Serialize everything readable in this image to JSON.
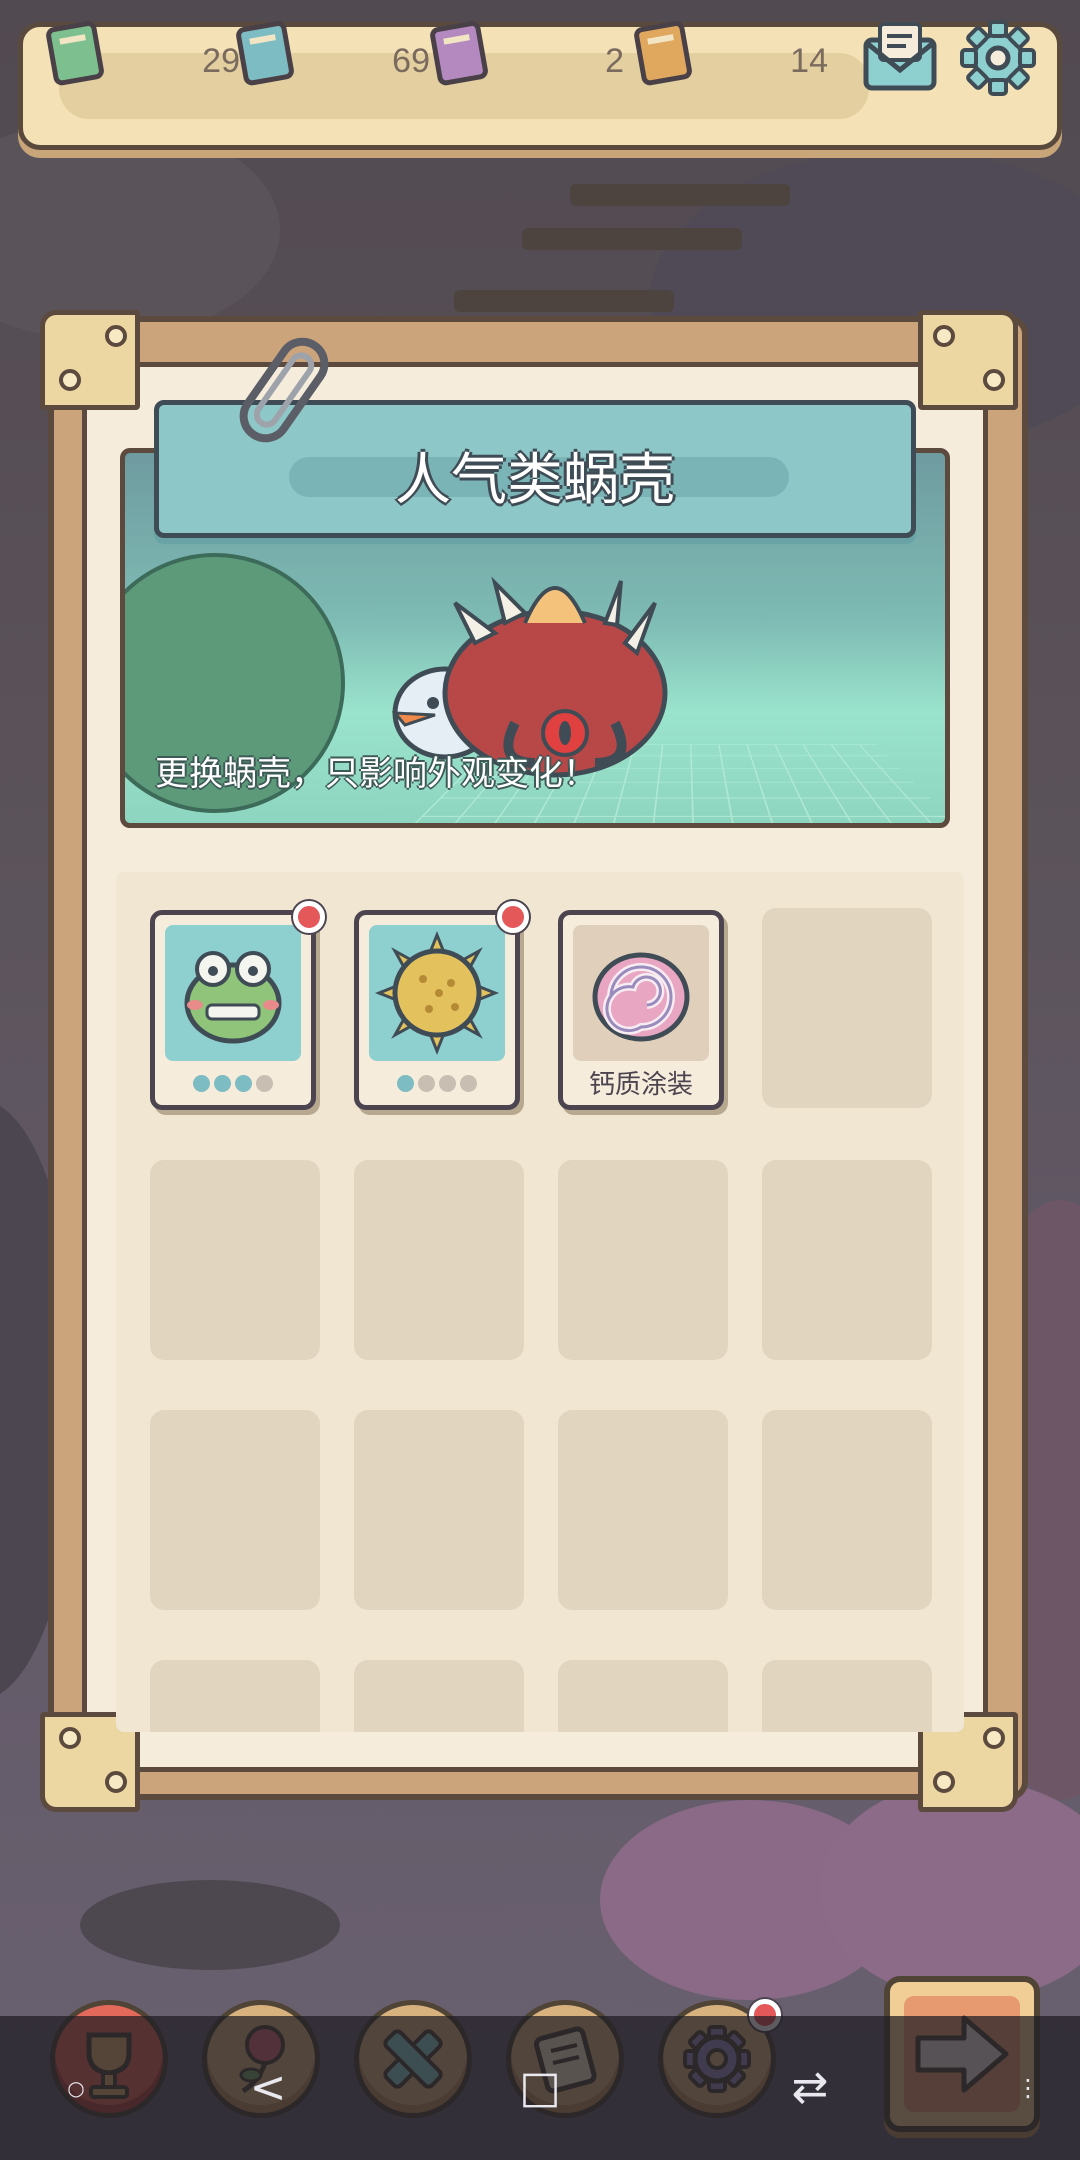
{
  "currencies": [
    {
      "name": "green-ticket",
      "value": "29",
      "color": "#7dbf8e"
    },
    {
      "name": "teal-ticket",
      "value": "69",
      "color": "#7dbcc2"
    },
    {
      "name": "purple-ticket",
      "value": "2",
      "color": "#b489c0"
    },
    {
      "name": "orange-ticket",
      "value": "14",
      "color": "#e0a85f"
    }
  ],
  "topbar": {
    "mail_icon": "mail-icon",
    "settings_icon": "gear-icon"
  },
  "panel": {
    "title": "人气类蜗壳",
    "banner_caption": "更换蜗壳，只影响外观变化！"
  },
  "items": [
    {
      "name": "frog-shell",
      "icon": "frog-icon",
      "bg": "#8ecfd0",
      "level": 3,
      "max_level": 4,
      "badge": true,
      "label": ""
    },
    {
      "name": "pufferfish-shell",
      "icon": "pufferfish-icon",
      "bg": "#8ecfd0",
      "level": 1,
      "max_level": 4,
      "badge": true,
      "label": ""
    },
    {
      "name": "calcium-coating-shell",
      "icon": "spiral-shell-icon",
      "bg": "#e0cfbb",
      "level": 0,
      "max_level": 0,
      "badge": false,
      "label": "钙质涂装"
    }
  ],
  "bottom_nav": [
    {
      "name": "trophy",
      "icon": "trophy-icon",
      "active": true
    },
    {
      "name": "rose",
      "icon": "rose-icon",
      "active": false
    },
    {
      "name": "cross",
      "icon": "cross-icon",
      "active": false
    },
    {
      "name": "scroll",
      "icon": "scroll-icon",
      "active": false
    },
    {
      "name": "settings",
      "icon": "gear-icon",
      "active": false,
      "badge": true
    }
  ],
  "next_button": {
    "icon": "arrow-right-icon"
  },
  "system_nav": {
    "back": "<",
    "home": "□",
    "switch": "⇄"
  },
  "colors": {
    "accent_red": "#e4585a",
    "teal": "#8ecfd0",
    "panel_bg": "#f5ecdc",
    "frame": "#cba47c"
  }
}
